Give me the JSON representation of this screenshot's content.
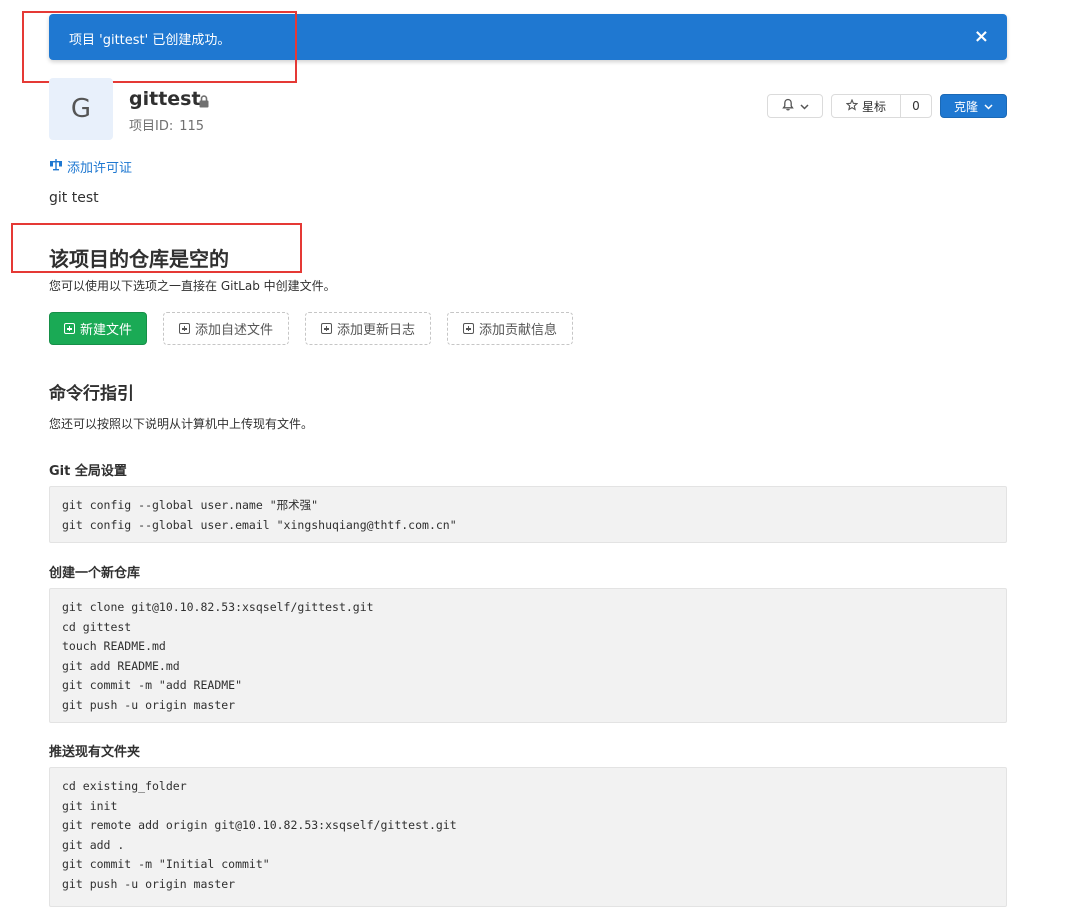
{
  "flash": {
    "message": "项目 'gittest' 已创建成功。",
    "close": "×"
  },
  "project": {
    "avatar_letter": "G",
    "name": "gittest",
    "id_label": "项目ID:",
    "id_value": "115"
  },
  "header_actions": {
    "star_label": "星标",
    "star_count": "0",
    "clone_label": "克隆"
  },
  "license_link": "添加许可证",
  "description": "git test",
  "empty": {
    "title": "该项目的仓库是空的",
    "subtitle": "您可以使用以下选项之一直接在 GitLab 中创建文件。",
    "buttons": {
      "new_file": "新建文件",
      "add_readme": "添加自述文件",
      "add_changelog": "添加更新日志",
      "add_contributing": "添加贡献信息"
    }
  },
  "cli": {
    "title": "命令行指引",
    "subtitle": "您还可以按照以下说明从计算机中上传现有文件。",
    "sections": [
      {
        "title": "Git 全局设置",
        "code": "git config --global user.name \"邢术强\"\ngit config --global user.email \"xingshuqiang@thtf.com.cn\""
      },
      {
        "title": "创建一个新仓库",
        "code": "git clone git@10.10.82.53:xsqself/gittest.git\ncd gittest\ntouch README.md\ngit add README.md\ngit commit -m \"add README\"\ngit push -u origin master"
      },
      {
        "title": "推送现有文件夹",
        "code": "cd existing_folder\ngit init\ngit remote add origin git@10.10.82.53:xsqself/gittest.git\ngit add .\ngit commit -m \"Initial commit\"\ngit push -u origin master"
      }
    ]
  },
  "colors": {
    "flash_blue": "#1f78d1",
    "success_green": "#1aaa55",
    "annotation_red": "#e53935",
    "link_blue": "#1f78d1"
  }
}
